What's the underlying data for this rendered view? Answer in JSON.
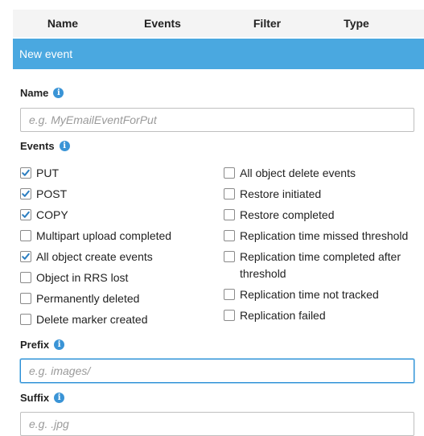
{
  "table_header": {
    "columns": [
      "Name",
      "Events",
      "Filter",
      "Type"
    ]
  },
  "new_event": {
    "title": "New event"
  },
  "name_field": {
    "label": "Name",
    "placeholder": "e.g. MyEmailEventForPut",
    "value": ""
  },
  "events": {
    "label": "Events",
    "left": [
      {
        "label": "PUT",
        "checked": true
      },
      {
        "label": "POST",
        "checked": true
      },
      {
        "label": "COPY",
        "checked": true
      },
      {
        "label": "Multipart upload completed",
        "checked": false
      },
      {
        "label": "All object create events",
        "checked": true
      },
      {
        "label": "Object in RRS lost",
        "checked": false
      },
      {
        "label": "Permanently deleted",
        "checked": false
      },
      {
        "label": "Delete marker created",
        "checked": false
      }
    ],
    "right": [
      {
        "label": "All object delete events",
        "checked": false
      },
      {
        "label": "Restore initiated",
        "checked": false
      },
      {
        "label": "Restore completed",
        "checked": false
      },
      {
        "label": "Replication time missed threshold",
        "checked": false
      },
      {
        "label": "Replication time completed after threshold",
        "checked": false
      },
      {
        "label": "Replication time not tracked",
        "checked": false
      },
      {
        "label": "Replication failed",
        "checked": false
      }
    ]
  },
  "prefix_field": {
    "label": "Prefix",
    "placeholder": "e.g. images/",
    "value": ""
  },
  "suffix_field": {
    "label": "Suffix",
    "placeholder": "e.g. .jpg",
    "value": ""
  },
  "colors": {
    "accent": "#4aa8e0",
    "check": "#2d7fc1",
    "info_icon": "#3a94d6"
  },
  "icons": {
    "info": "info-icon",
    "check": "check-icon"
  }
}
